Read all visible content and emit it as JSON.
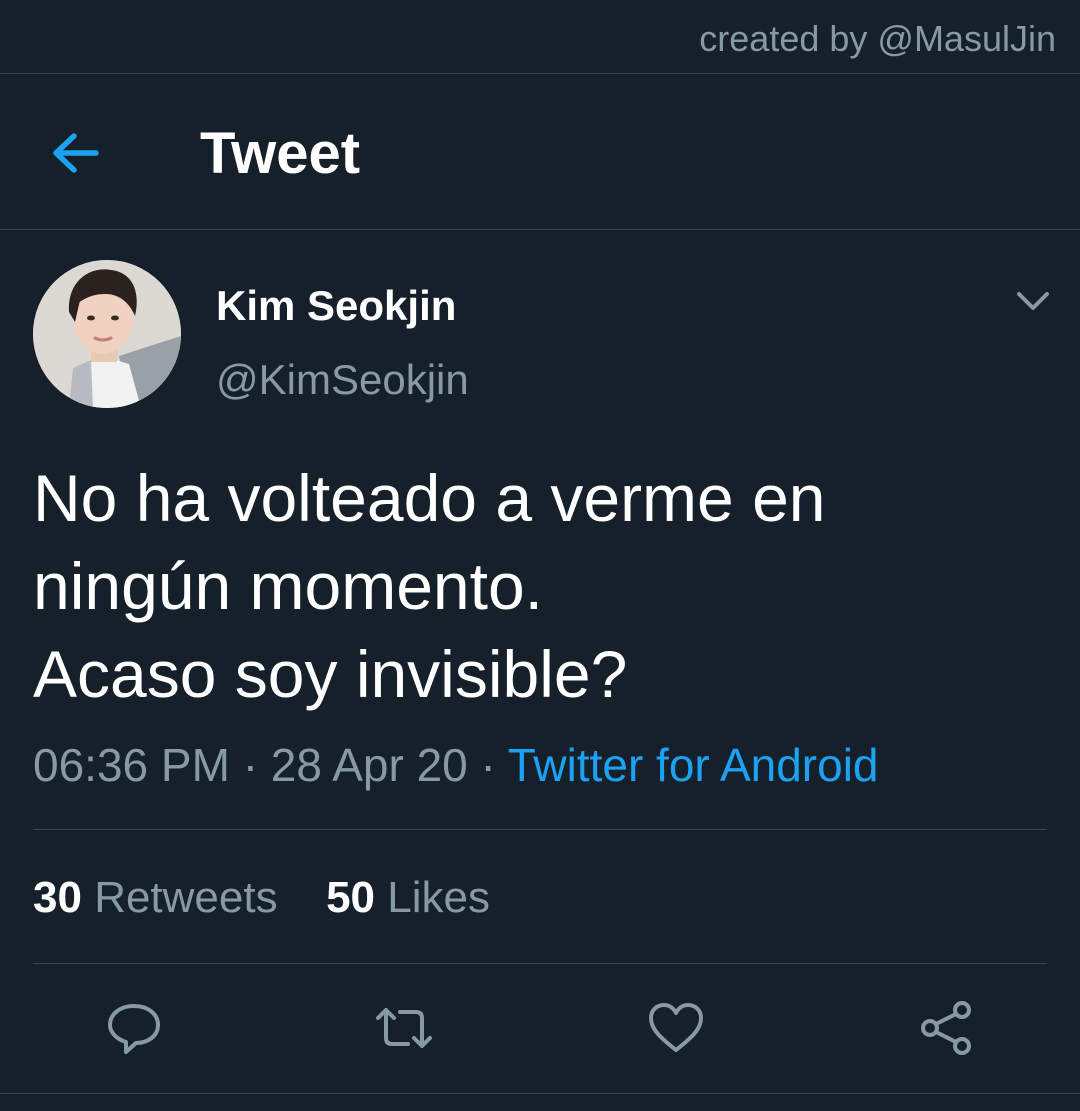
{
  "credit": "created by @MasulJin",
  "header": {
    "title": "Tweet",
    "back_icon": "arrow-left-icon"
  },
  "author": {
    "display_name": "Kim Seokjin",
    "handle": "@KimSeokjin",
    "avatar": "profile-photo"
  },
  "tweet": {
    "lines": [
      "No ha volteado a verme en",
      "ningún momento.",
      "Acaso soy invisible?"
    ],
    "time": "06:36 PM",
    "date": "28 Apr 20",
    "separator": "·",
    "source": "Twitter for Android"
  },
  "stats": {
    "retweets_count": "30",
    "retweets_label": "Retweets",
    "likes_count": "50",
    "likes_label": "Likes"
  },
  "actions": [
    "reply-icon",
    "retweet-icon",
    "like-icon",
    "share-icon"
  ],
  "colors": {
    "background": "#15202b",
    "accent": "#1da1f2",
    "secondary_text": "#8899a6",
    "divider": "#38444d"
  }
}
